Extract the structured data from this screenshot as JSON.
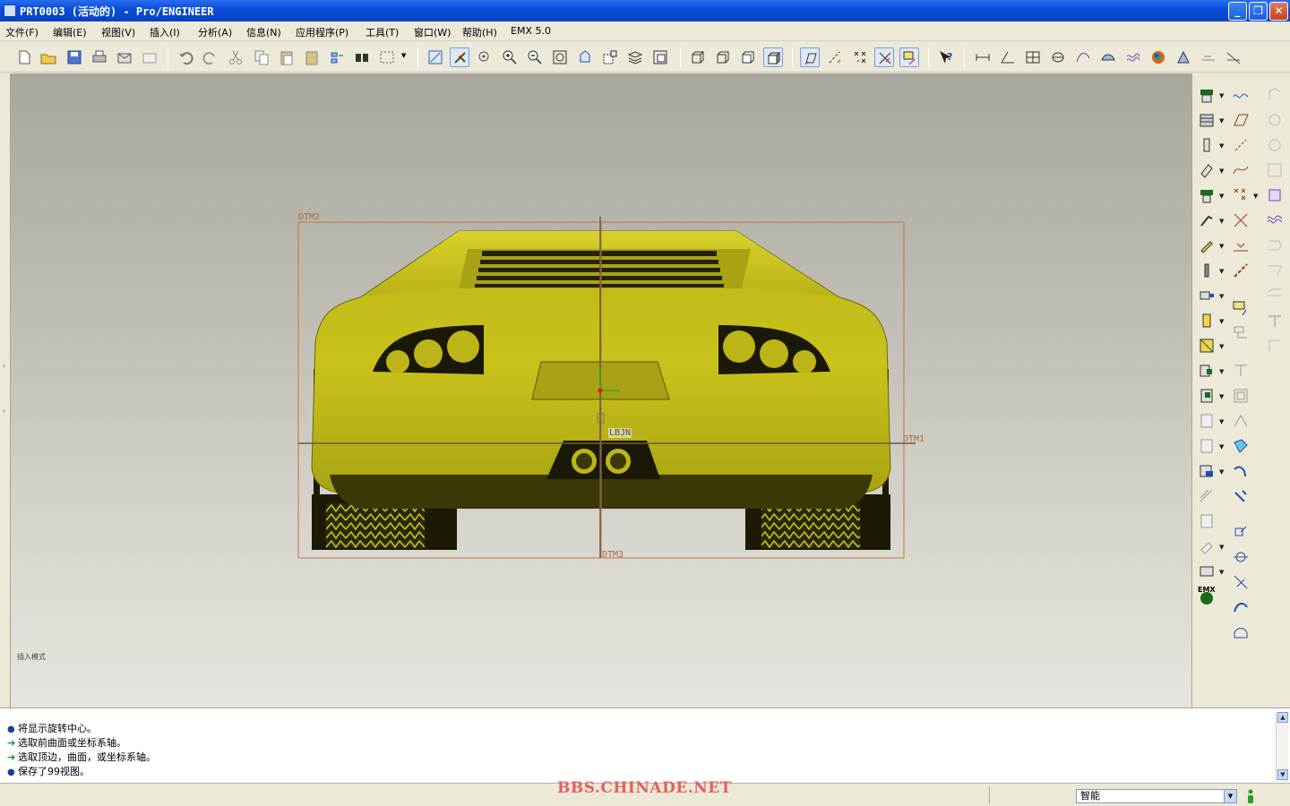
{
  "window": {
    "title": "PRT0003 (活动的) - Pro/ENGINEER",
    "minimize": "_",
    "maximize": "❐",
    "close": "✕"
  },
  "menu": {
    "items": [
      "文件(F)",
      "编辑(E)",
      "视图(V)",
      "插入(I)",
      "分析(A)",
      "信息(N)",
      "应用程序(P)",
      "工具(T)",
      "窗口(W)",
      "帮助(H)",
      "EMX 5.0"
    ]
  },
  "viewport": {
    "datums": {
      "top_plane": "DTM2",
      "right_plane": "DTM1",
      "bottom_plane": "DTM3",
      "center_label": "LBJN"
    },
    "mode_text": "插入模式",
    "car_color": "#c8c019",
    "frame_color": "#b8764a"
  },
  "right_toolbar": {
    "emx_label": "EMX"
  },
  "messages": [
    {
      "type": "info",
      "text": "将显示旋转中心。"
    },
    {
      "type": "prompt",
      "text": "选取前曲面或坐标系轴。"
    },
    {
      "type": "prompt",
      "text": "选取顶边，曲面，或坐标系轴。"
    },
    {
      "type": "info",
      "text": "保存了99视图。"
    }
  ],
  "statusbar": {
    "watermark": "BBS.CHINADE.NET",
    "filter_value": "智能"
  },
  "icons": {
    "bullet": "●",
    "prompt_arrow": "➔",
    "dropdown": "▼",
    "up": "▲",
    "down": "▼",
    "left_arrow_1": "›",
    "left_arrow_2": "›"
  }
}
